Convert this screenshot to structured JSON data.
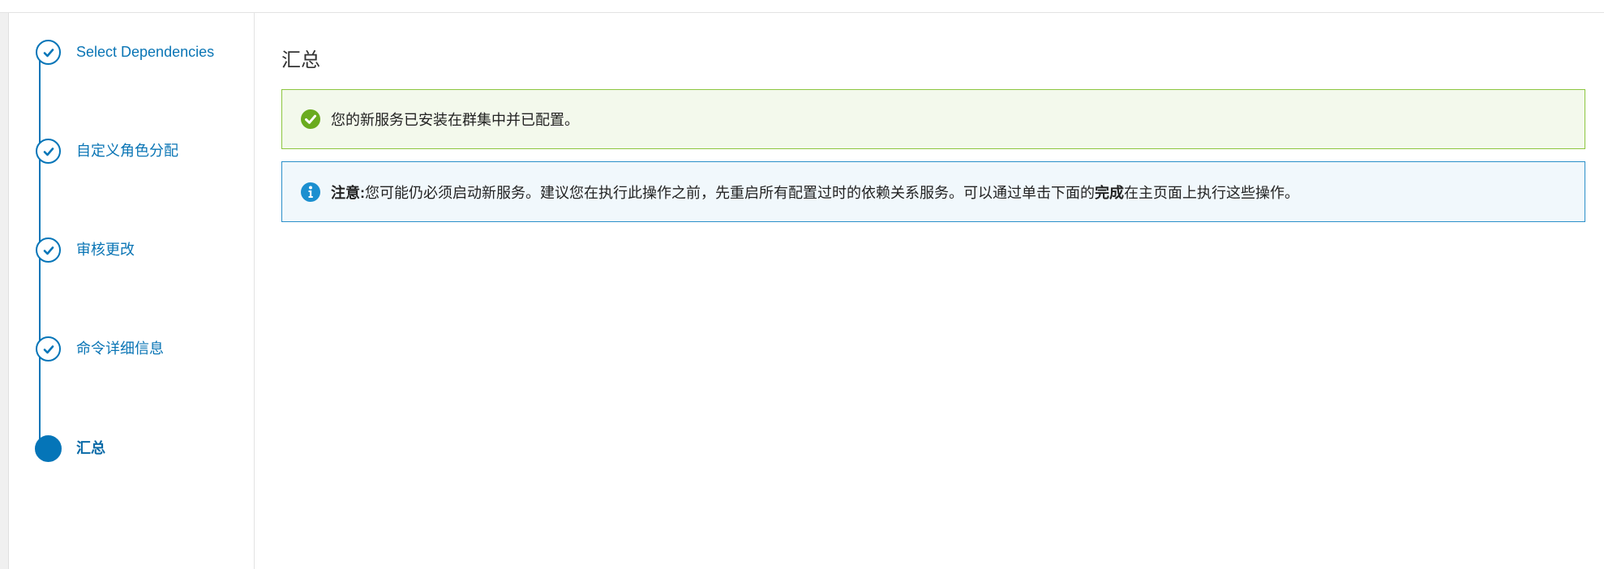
{
  "wizard": {
    "steps": [
      {
        "label": "Select Dependencies",
        "status": "completed"
      },
      {
        "label": "自定义角色分配",
        "status": "completed"
      },
      {
        "label": "审核更改",
        "status": "completed"
      },
      {
        "label": "命令详细信息",
        "status": "completed"
      },
      {
        "label": "汇总",
        "status": "active"
      }
    ]
  },
  "main": {
    "title": "汇总",
    "success_message": "您的新服务已安装在群集中并已配置。",
    "info": {
      "label": "注意:",
      "text_before": "您可能仍必须启动新服务。建议您在执行此操作之前，先重启所有配置过时的依赖关系服务。可以通过单击下面的",
      "emphasis": "完成",
      "text_after": "在主页面上执行这些操作。"
    }
  },
  "colors": {
    "primary": "#0575b8",
    "success_border": "#8cc63f",
    "success_bg": "#f3f9ec",
    "success_icon": "#6aab1f",
    "info_border": "#2a8fc9",
    "info_bg": "#f1f8fc",
    "info_icon": "#1b8fd0"
  },
  "icons": {
    "completed_step": "check-icon",
    "success": "check-circle-icon",
    "info": "info-circle-icon"
  }
}
